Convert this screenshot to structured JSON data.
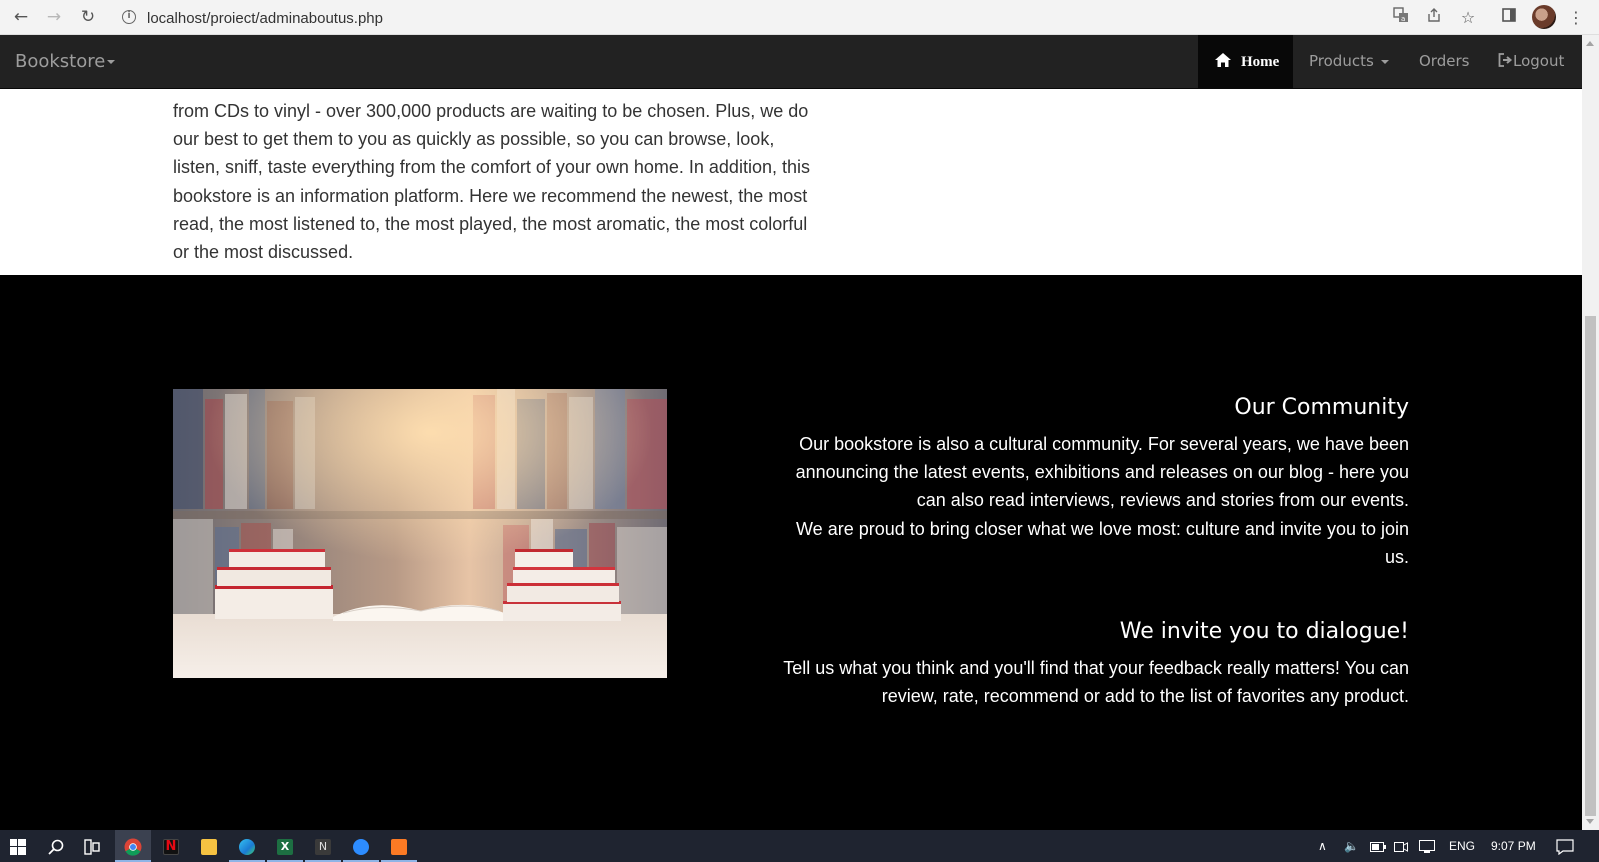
{
  "browser": {
    "url": "localhost/proiect/adminaboutus.php",
    "info_symbol": "i"
  },
  "navbar": {
    "brand": "Bookstore",
    "items": [
      {
        "label": "Home",
        "active": true,
        "icon": "home-icon"
      },
      {
        "label": "Products",
        "dropdown": true
      },
      {
        "label": "Orders"
      },
      {
        "label": "Logout",
        "icon": "logout-icon"
      }
    ]
  },
  "intro": {
    "lines": [
      "from CDs to vinyl - over 300,000 products are waiting to be chosen. Plus, we do",
      "our best to get them to you as quickly as possible, so you can browse, look,",
      "listen, sniff, taste everything from the comfort of your own home. In addition, this",
      "bookstore is an information platform. Here we recommend the newest, the most",
      "read, the most listened to, the most played, the most aromatic, the most colorful",
      "or the most discussed."
    ]
  },
  "community": {
    "heading": "Our Community",
    "lines": [
      "Our bookstore is also a cultural community. For several years, we have been",
      "announcing the latest events, exhibitions and releases on our blog - here you",
      "can also read interviews, reviews and stories from our events.",
      "We are proud to bring closer what we love most: culture and invite you to join",
      "us."
    ]
  },
  "dialogue": {
    "heading": "We invite you to dialogue!",
    "lines": [
      "Tell us what you think and you'll find that your feedback really matters! You can",
      "review, rate, recommend or add to the list of favorites any product."
    ]
  },
  "taskbar": {
    "language": "ENG",
    "time": "9:07 PM"
  },
  "colors": {
    "navbar_bg": "#222222",
    "nav_active_bg": "#080808",
    "dark_section_bg": "#000000",
    "taskbar_bg": "#1f2430"
  }
}
